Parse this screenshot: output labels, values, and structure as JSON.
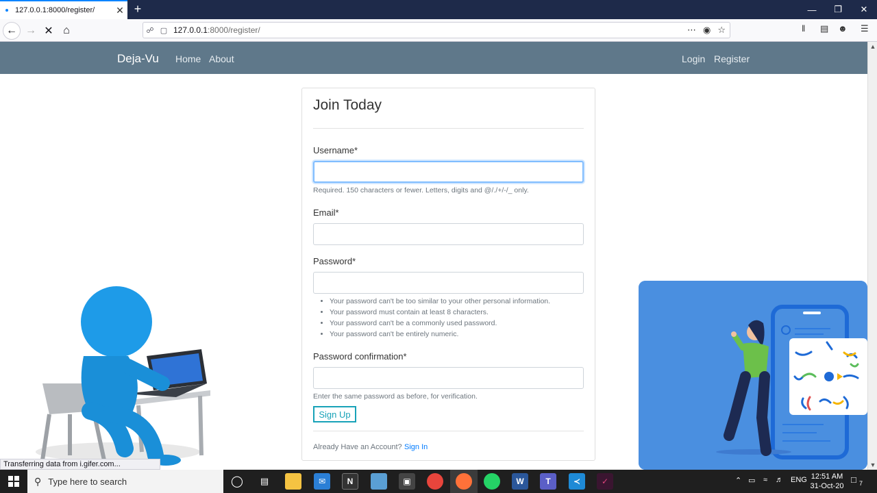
{
  "browser": {
    "tab_title": "127.0.0.1:8000/register/",
    "url_host": "127.0.0.1",
    "url_rest": ":8000/register/",
    "new_tab": "+",
    "tab_close": "✕"
  },
  "site": {
    "brand": "Deja-Vu",
    "nav_left": [
      "Home",
      "About"
    ],
    "nav_right": [
      "Login",
      "Register"
    ]
  },
  "form": {
    "title": "Join Today",
    "username_label": "Username*",
    "username_help": "Required. 150 characters or fewer. Letters, digits and @/./+/-/_ only.",
    "email_label": "Email*",
    "password_label": "Password*",
    "password_help": [
      "Your password can't be too similar to your other personal information.",
      "Your password must contain at least 8 characters.",
      "Your password can't be a commonly used password.",
      "Your password can't be entirely numeric."
    ],
    "confirm_label": "Password confirmation*",
    "confirm_help": "Enter the same password as before, for verification.",
    "submit": "Sign Up",
    "already": "Already Have an Account?",
    "signin": "Sign In"
  },
  "status_text": "Transferring data from i.gifer.com...",
  "taskbar": {
    "search_placeholder": "Type here to search",
    "lang": "ENG",
    "time": "12:51 AM",
    "date": "31-Oct-20",
    "notif_count": "7"
  }
}
